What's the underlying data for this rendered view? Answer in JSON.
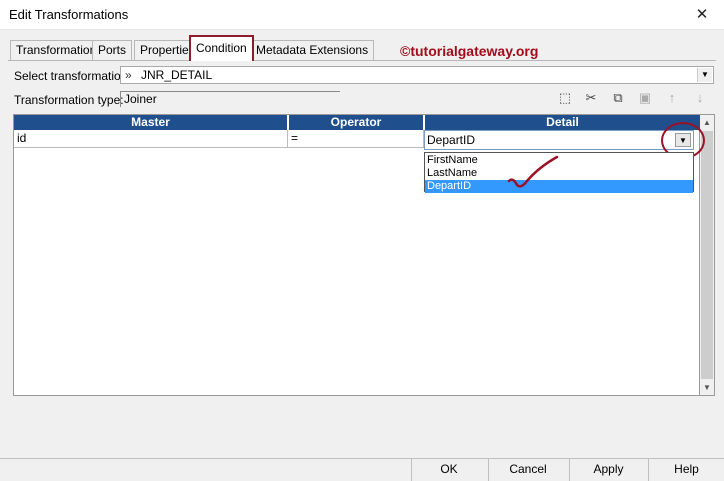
{
  "window": {
    "title": "Edit Transformations",
    "close_glyph": "✕"
  },
  "tabs": [
    {
      "label": "Transformation"
    },
    {
      "label": "Ports"
    },
    {
      "label": "Properties"
    },
    {
      "label": "Condition",
      "active": true
    },
    {
      "label": "Metadata Extensions"
    }
  ],
  "watermark": "©tutorialgateway.org",
  "select_transformation": {
    "label": "Select transformation:",
    "value": "JNR_DETAIL",
    "icon": "joiner-icon"
  },
  "transformation_type": {
    "label": "Transformation type:",
    "value": "Joiner"
  },
  "toolbar": {
    "icons": [
      "new-icon",
      "cut-icon",
      "copy-icon",
      "paste-icon",
      "move-up-icon",
      "move-down-icon"
    ]
  },
  "grid": {
    "columns": [
      "Master",
      "Operator",
      "Detail"
    ],
    "rows": [
      {
        "master": "id",
        "operator": "=",
        "detail": "DepartID"
      }
    ],
    "header_color": "#1f4f8c"
  },
  "detail_dropdown": {
    "selected": "DepartID",
    "options": [
      "FirstName",
      "LastName",
      "DepartID"
    ],
    "highlight_color": "#3399ff"
  },
  "annotation_color": "#9b1228",
  "buttons": {
    "ok": "OK",
    "cancel": "Cancel",
    "apply": "Apply",
    "help": "Help"
  }
}
